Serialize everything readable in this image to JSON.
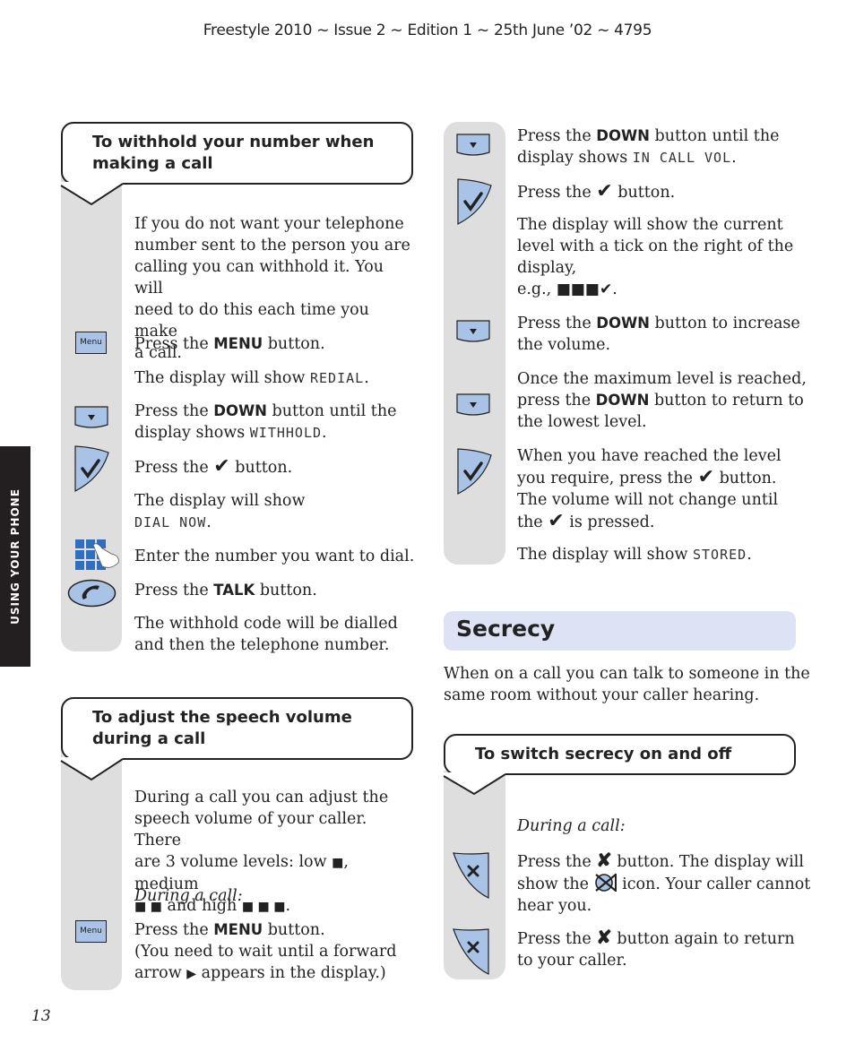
{
  "header": {
    "text": "Freestyle 2010 ~ Issue 2 ~ Edition 1 ~ 25th June ’02 ~ 4795"
  },
  "side_tab": {
    "label": "USING YOUR PHONE"
  },
  "page_number": "13",
  "colors": {
    "button_fill": "#a9c3e6",
    "strip_gray": "#dedede",
    "secrecy_bar": "#dde3f4",
    "side_tab": "#231f20"
  },
  "withhold": {
    "title_line1": "To withhold your number when",
    "title_line2": "making a call",
    "intro": [
      "If you do not want your telephone",
      "number sent to the person you are",
      "calling you can withhold it. You will",
      "need to do this each time you make",
      "a call."
    ],
    "menu_icon_label": "Menu",
    "step1": {
      "pre": "Press the ",
      "key": "MENU",
      "post": " button."
    },
    "step2": {
      "pre": "The display will show ",
      "lcd": "REDIAL",
      "post": "."
    },
    "step3": {
      "pre": "Press the ",
      "key": "DOWN",
      "post": " button until the",
      "line2_pre": "display shows ",
      "lcd": "WITHHOLD",
      "line2_post": "."
    },
    "step4": {
      "pre": "Press the ",
      "glyph": "✔",
      "post": " button."
    },
    "step5": {
      "line1": "The display will show",
      "lcd": "DIAL NOW",
      "post": "."
    },
    "step6": {
      "text": "Enter the number you want to dial."
    },
    "step7": {
      "pre": "Press the ",
      "key": "TALK",
      "post": " button."
    },
    "step8": {
      "line1": "The withhold code will be dialled",
      "line2": "and then the telephone number."
    }
  },
  "volume": {
    "title_line1": "To adjust the speech volume",
    "title_line2": "during a call",
    "intro_line1": "During a call you can adjust the",
    "intro_line2": "speech volume of your caller. There",
    "intro_line3_pre": "are 3 volume levels:  low ",
    "low_glyph": "■",
    "intro_line3_post": ", medium",
    "medium_glyph": "■ ■",
    "intro_line4_mid": " and high ",
    "high_glyph": "■ ■ ■",
    "intro_line4_post": ".",
    "during": "During a call:",
    "menu_icon_label": "Menu",
    "step_menu": {
      "pre": "Press the ",
      "key": "MENU",
      "post": " button.",
      "line2": "(You need to wait until a forward",
      "line3_pre": "arrow ",
      "arrow": "▶",
      "line3_post": " appears in the display.)"
    }
  },
  "right_col": {
    "step1": {
      "pre": "Press the ",
      "key": "DOWN",
      "post": " button until the",
      "line2_pre": "display shows ",
      "lcd": "IN CALL VOL",
      "line2_post": "."
    },
    "step2": {
      "pre": "Press the ",
      "glyph": "✔",
      "post": " button."
    },
    "step3": {
      "line1": "The display will show the current",
      "line2": "level with a tick on the right of the",
      "line3": "display,",
      "line4_pre": "e.g., ",
      "example": "■■■✔",
      "line4_post": "."
    },
    "step4": {
      "pre": "Press the ",
      "key": "DOWN",
      "post": " button to increase",
      "line2": "the volume."
    },
    "step5": {
      "line1": "Once the maximum level is reached,",
      "line2_pre": "press the ",
      "key": "DOWN",
      "line2_post": " button to return to",
      "line3": "the lowest level."
    },
    "step6": {
      "line1": "When you have reached the level",
      "line2_pre": "you require, press the ",
      "glyph": "✔",
      "line2_post": " button.",
      "line3": "The volume will not change until",
      "line4_pre": "the ",
      "line4_post": " is pressed."
    },
    "step7": {
      "pre": "The display will show ",
      "lcd": "STORED",
      "post": "."
    }
  },
  "secrecy": {
    "heading": "Secrecy",
    "intro_line1": "When on a call you can talk to someone in the",
    "intro_line2": "same room without your caller hearing.",
    "callout_title": "To switch secrecy on and off",
    "during": "During a call:",
    "step1": {
      "pre": "Press the ",
      "glyph": "✘",
      "post": " button. The display will",
      "line2_pre": "show the ",
      "line2_post": " icon. Your caller cannot",
      "line3": "hear you."
    },
    "step2": {
      "pre": "Press the ",
      "glyph": "✘",
      "post": " button again to return",
      "line2": "to your caller."
    }
  }
}
